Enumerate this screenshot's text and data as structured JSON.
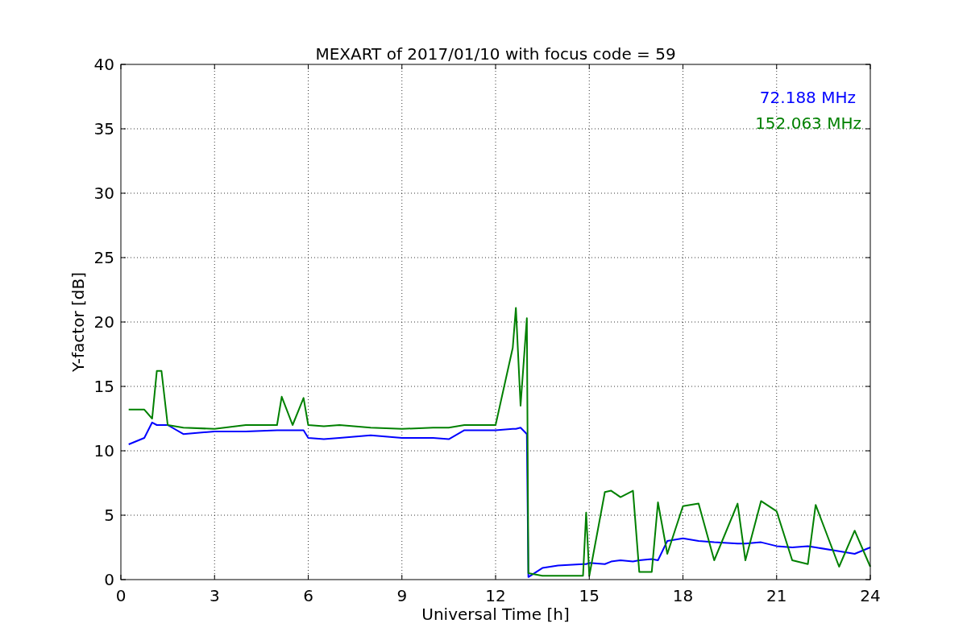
{
  "chart_data": {
    "type": "line",
    "title": "MEXART of 2017/01/10 with focus code = 59",
    "xlabel": "Universal Time [h]",
    "ylabel": "Y-factor [dB]",
    "x": [
      0.25,
      0.75,
      1.0,
      1.15,
      1.3,
      1.5,
      2,
      3,
      4,
      5,
      5.15,
      5.5,
      5.85,
      6,
      6.5,
      7,
      8,
      9,
      10,
      10.5,
      11,
      12,
      12.55,
      12.65,
      12.8,
      13.0,
      13.05,
      13.5,
      14,
      14.8,
      14.9,
      15,
      15.5,
      15.7,
      16,
      16.4,
      16.6,
      17,
      17.2,
      17.5,
      18,
      18.5,
      19,
      19.75,
      20,
      20.5,
      21,
      21.5,
      22,
      22.25,
      23,
      23.5,
      24
    ],
    "series": [
      {
        "name": "72.188 MHz",
        "color": "#0000ff",
        "values": [
          10.5,
          11,
          12.2,
          12,
          12,
          12,
          11.3,
          11.5,
          11.5,
          11.6,
          11.6,
          11.6,
          11.6,
          11,
          10.9,
          11,
          11.2,
          11,
          11,
          10.9,
          11.6,
          11.6,
          11.7,
          11.7,
          11.8,
          11.3,
          0.2,
          0.9,
          1.1,
          1.2,
          1.2,
          1.3,
          1.2,
          1.4,
          1.5,
          1.4,
          1.5,
          1.6,
          1.5,
          3,
          3.2,
          3,
          2.9,
          2.8,
          2.8,
          2.9,
          2.6,
          2.5,
          2.6,
          2.5,
          2.2,
          2,
          2.5
        ]
      },
      {
        "name": "152.063 MHz",
        "color": "#008000",
        "values": [
          13.2,
          13.2,
          12.5,
          16.2,
          16.2,
          12,
          11.8,
          11.7,
          12,
          12,
          14.2,
          12,
          14.1,
          12,
          11.9,
          12,
          11.8,
          11.7,
          11.8,
          11.8,
          12,
          12,
          18,
          21.1,
          13.5,
          20.3,
          0.5,
          0.3,
          0.3,
          0.3,
          5.2,
          0.3,
          6.8,
          6.9,
          6.4,
          6.9,
          0.6,
          0.6,
          6,
          2,
          5.7,
          5.9,
          1.5,
          5.9,
          1.5,
          6.1,
          5.3,
          1.5,
          1.2,
          5.8,
          1,
          3.8,
          1
        ]
      }
    ],
    "grid": true,
    "xlim": [
      0,
      24
    ],
    "ylim": [
      0,
      40
    ],
    "xticks": [
      0,
      3,
      6,
      9,
      12,
      15,
      18,
      21,
      24
    ],
    "yticks": [
      0,
      5,
      10,
      15,
      20,
      25,
      30,
      35,
      40
    ]
  }
}
